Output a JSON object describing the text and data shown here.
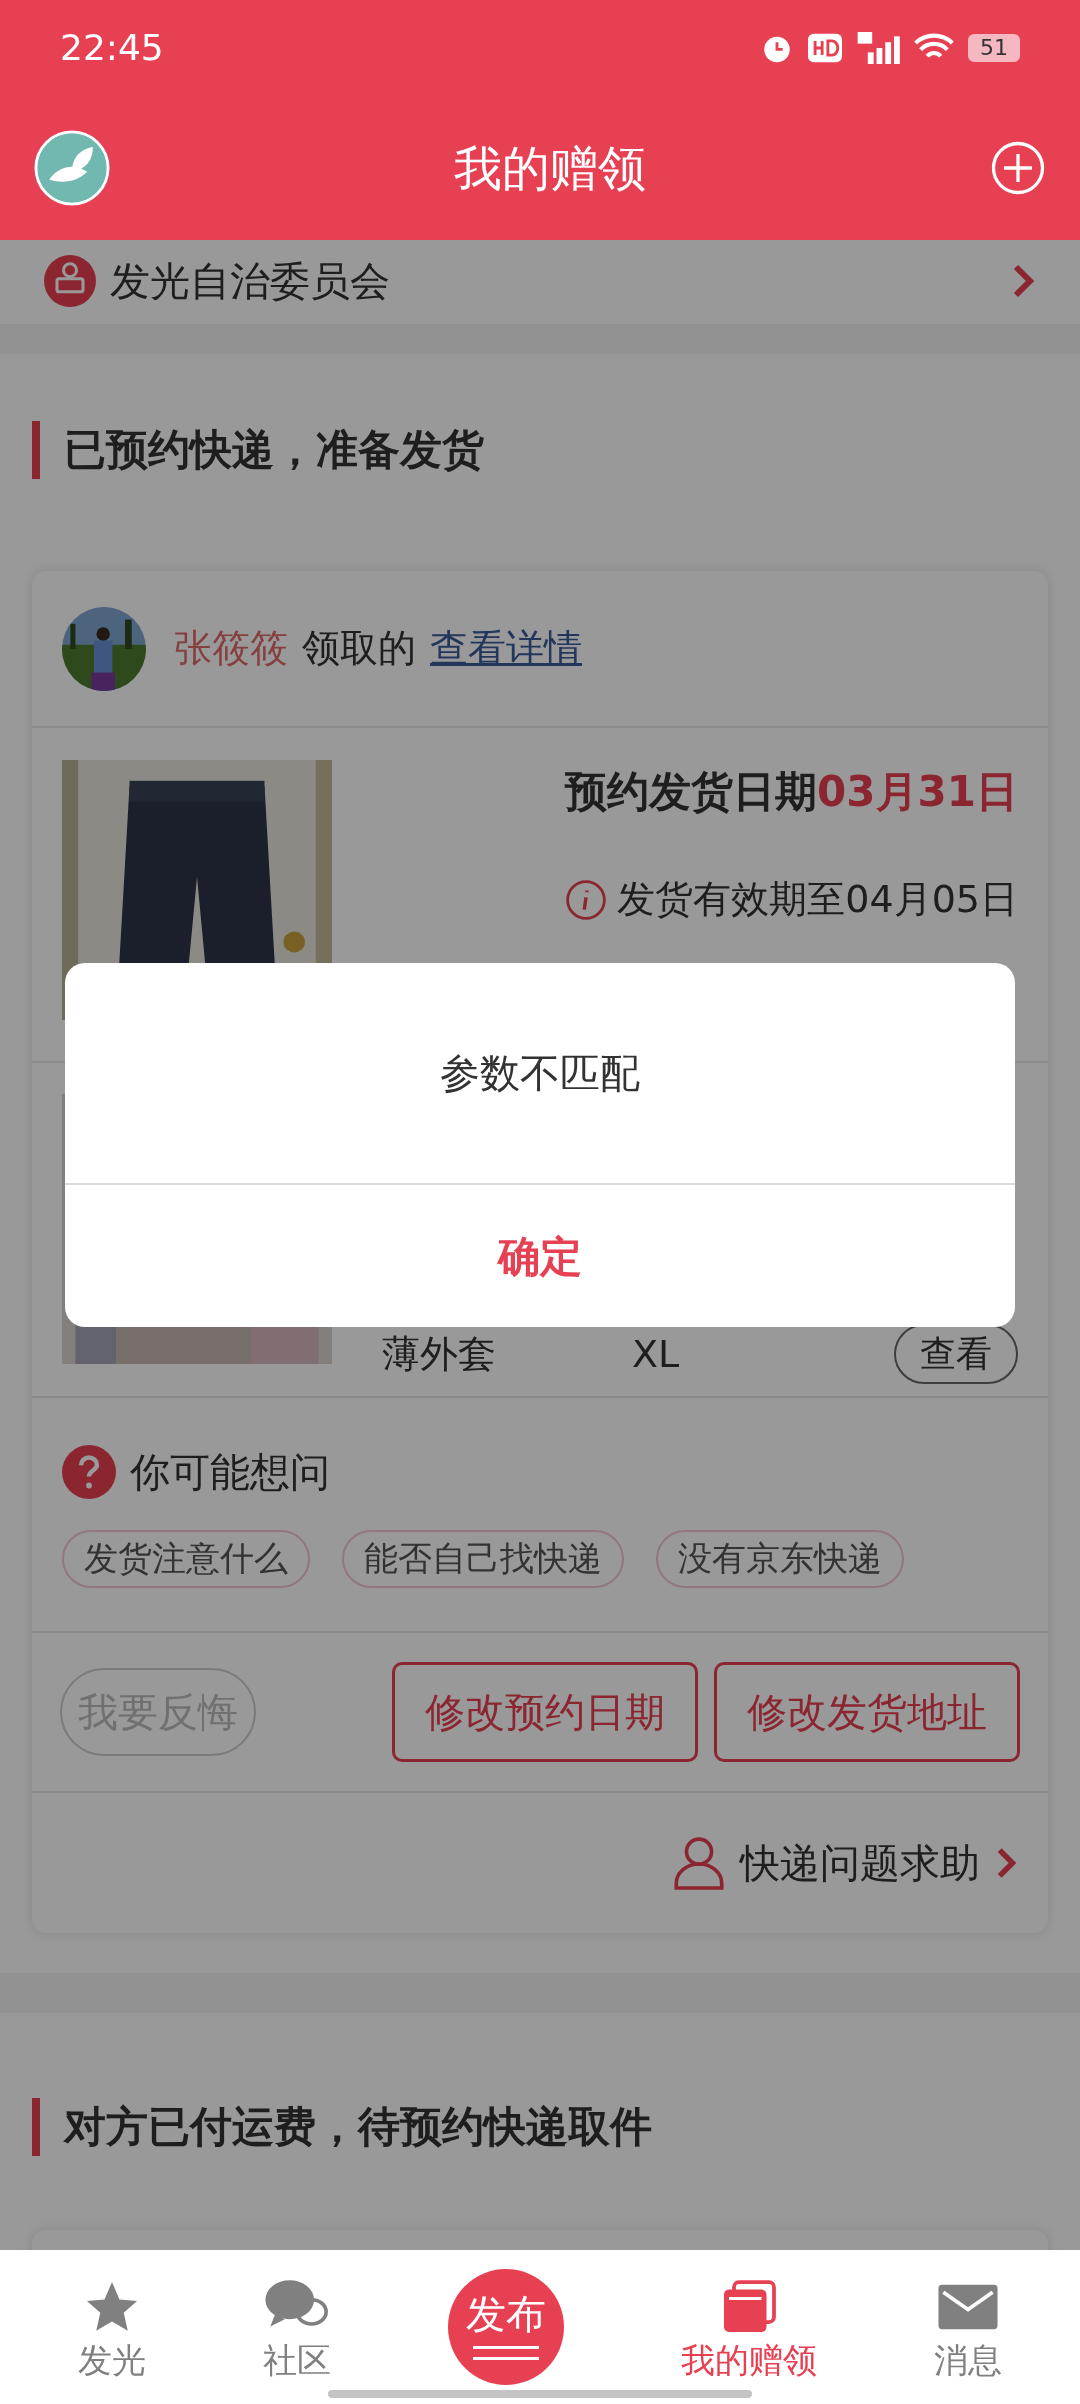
{
  "status_bar": {
    "time": "22:45",
    "battery": "51"
  },
  "header": {
    "title": "我的赠领"
  },
  "group_row": {
    "label": "发光自治委员会"
  },
  "section_1": {
    "title": "已预约快递，准备发货",
    "card": {
      "claimer": {
        "name": "张筱筱",
        "text": "领取的",
        "link": "查看详情"
      },
      "shipping": {
        "label": "预约发货日期",
        "date": "03月31日",
        "validity": "发货有效期至04月05日"
      },
      "item": {
        "name": "薄外套",
        "size": "XL",
        "action": "查看"
      },
      "faq": {
        "title": "你可能想问",
        "chips": [
          "发货注意什么",
          "能否自己找快递",
          "没有京东快递"
        ]
      },
      "actions": [
        {
          "label": "我要反悔",
          "disabled": true
        },
        {
          "label": "修改预约日期",
          "disabled": false
        },
        {
          "label": "修改发货地址",
          "disabled": false
        }
      ],
      "help": "快递问题求助"
    }
  },
  "section_2": {
    "title": "对方已付运费，待预约快递取件"
  },
  "dialog": {
    "message": "参数不匹配",
    "confirm": "确定"
  },
  "nav": [
    {
      "kind": "star",
      "label": "发光",
      "selected": false
    },
    {
      "kind": "chat",
      "label": "社区",
      "selected": false
    },
    {
      "kind": "publish",
      "label": "发布",
      "selected": false
    },
    {
      "kind": "cards",
      "label": "我的赠领",
      "selected": true
    },
    {
      "kind": "mail",
      "label": "消息",
      "selected": false
    }
  ]
}
